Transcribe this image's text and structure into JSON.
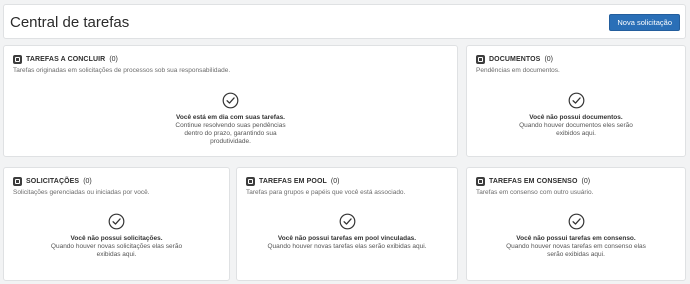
{
  "header": {
    "title": "Central de tarefas",
    "new_button": "Nova solicitação"
  },
  "cards": {
    "tarefas": {
      "title": "TAREFAS A CONCLUIR",
      "count": "(0)",
      "description": "Tarefas originadas em solicitações de processos sob sua responsabilidade.",
      "empty_title": "Você está em dia com suas tarefas.",
      "empty_text": "Continue resolvendo suas pendências dentro do prazo, garantindo sua produtividade."
    },
    "documentos": {
      "title": "DOCUMENTOS",
      "count": "(0)",
      "description": "Pendências em documentos.",
      "empty_title": "Você não possui documentos.",
      "empty_text": "Quando houver documentos eles serão exibidos aqui."
    },
    "solicitacoes": {
      "title": "SOLICITAÇÕES",
      "count": "(0)",
      "description": "Solicitações gerenciadas ou iniciadas por você.",
      "empty_title": "Você não possui solicitações.",
      "empty_text": "Quando houver novas solicitações elas serão exibidas aqui."
    },
    "pool": {
      "title": "TAREFAS EM POOL",
      "count": "(0)",
      "description": "Tarefas para grupos e papéis que você está associado.",
      "empty_title": "Você não possui tarefas em pool vinculadas.",
      "empty_text": "Quando houver novas tarefas elas serão exibidas aqui."
    },
    "consenso": {
      "title": "TAREFAS EM CONSENSO",
      "count": "(0)",
      "description": "Tarefas em consenso com outro usuário.",
      "empty_title": "Você não possui tarefas em consenso.",
      "empty_text": "Quando houver novas tarefas em consenso elas serão exibidas aqui."
    }
  }
}
